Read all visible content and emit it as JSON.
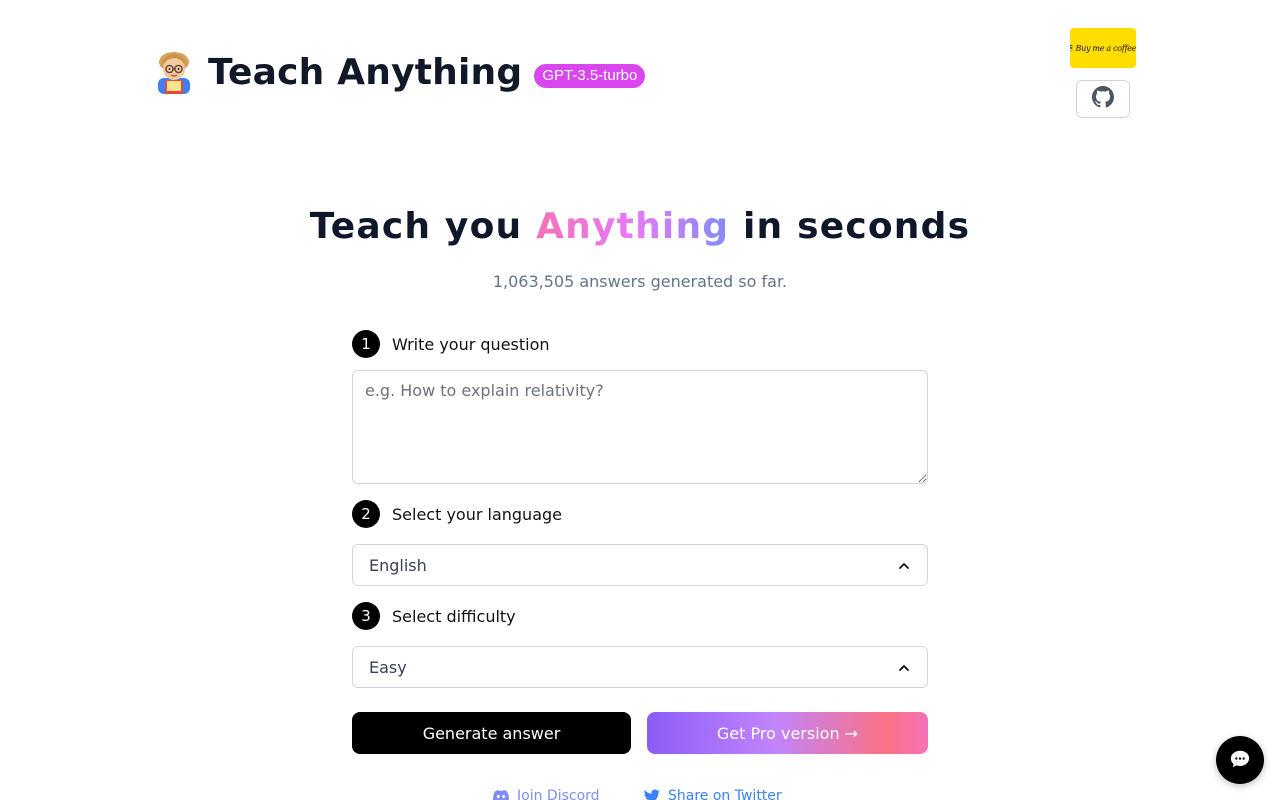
{
  "header": {
    "title": "Teach Anything",
    "model_badge": "GPT-3.5-turbo",
    "coffee_label": "Buy me a coffee"
  },
  "hero": {
    "title_prefix": "Teach you ",
    "title_accent": "Anything",
    "title_suffix": " in seconds",
    "answers_count": "1,063,505 answers generated so far."
  },
  "form": {
    "step1": {
      "number": "1",
      "label": "Write your question",
      "placeholder": "e.g. How to explain relativity?",
      "value": ""
    },
    "step2": {
      "number": "2",
      "label": "Select your language",
      "selected": "English"
    },
    "step3": {
      "number": "3",
      "label": "Select difficulty",
      "selected": "Easy"
    },
    "generate_label": "Generate answer",
    "pro_label": "Get Pro version →"
  },
  "footer": {
    "discord_label": "Join Discord",
    "twitter_label": "Share on Twitter"
  },
  "colors": {
    "badge": "#d946ef",
    "coffee": "#ffdd00",
    "primary": "#000000",
    "discord": "#818cf8",
    "twitter": "#3b82f6"
  },
  "icons": {
    "logo": "teacher-emoji-icon",
    "github": "github-icon",
    "chevron": "chevron-up-icon",
    "discord": "discord-icon",
    "twitter": "twitter-icon",
    "chat": "chat-bubble-icon"
  }
}
